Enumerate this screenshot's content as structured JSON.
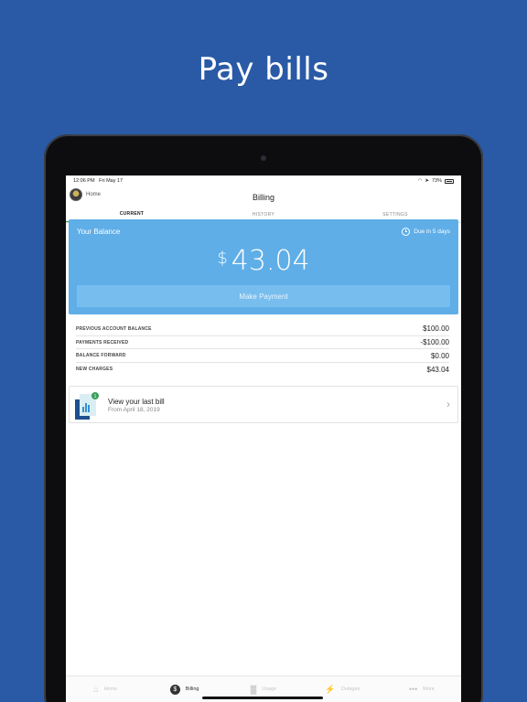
{
  "headline": "Pay bills",
  "status": {
    "time": "12:06 PM",
    "date": "Fri May 17",
    "battery": "73%"
  },
  "nav": {
    "back_label": "Home",
    "title": "Billing"
  },
  "tabs": [
    {
      "label": "CURRENT",
      "active": true
    },
    {
      "label": "HISTORY",
      "active": false
    },
    {
      "label": "SETTINGS",
      "active": false
    }
  ],
  "balance": {
    "label": "Your Balance",
    "due": "Due in 5 days",
    "currency": "$",
    "amount": "43.04",
    "pay_button": "Make Payment",
    "color": "#5faee8"
  },
  "summary": [
    {
      "label": "PREVIOUS ACCOUNT BALANCE",
      "value": "$100.00"
    },
    {
      "label": "PAYMENTS RECEIVED",
      "value": "-$100.00"
    },
    {
      "label": "BALANCE FORWARD",
      "value": "$0.00"
    },
    {
      "label": "NEW CHARGES",
      "value": "$43.04"
    }
  ],
  "last_bill": {
    "title": "View your last bill",
    "subtitle": "From April 18, 2019",
    "badge": "1"
  },
  "bottom_nav": [
    {
      "label": "Home",
      "icon": "home-icon",
      "active": false
    },
    {
      "label": "Billing",
      "icon": "dollar-icon",
      "active": true
    },
    {
      "label": "Usage",
      "icon": "bar-chart-icon",
      "active": false
    },
    {
      "label": "Outages",
      "icon": "lightning-icon",
      "active": false
    },
    {
      "label": "More",
      "icon": "more-icon",
      "active": false
    }
  ],
  "colors": {
    "background": "#2a5aa6",
    "accent": "#3b8f4a"
  }
}
